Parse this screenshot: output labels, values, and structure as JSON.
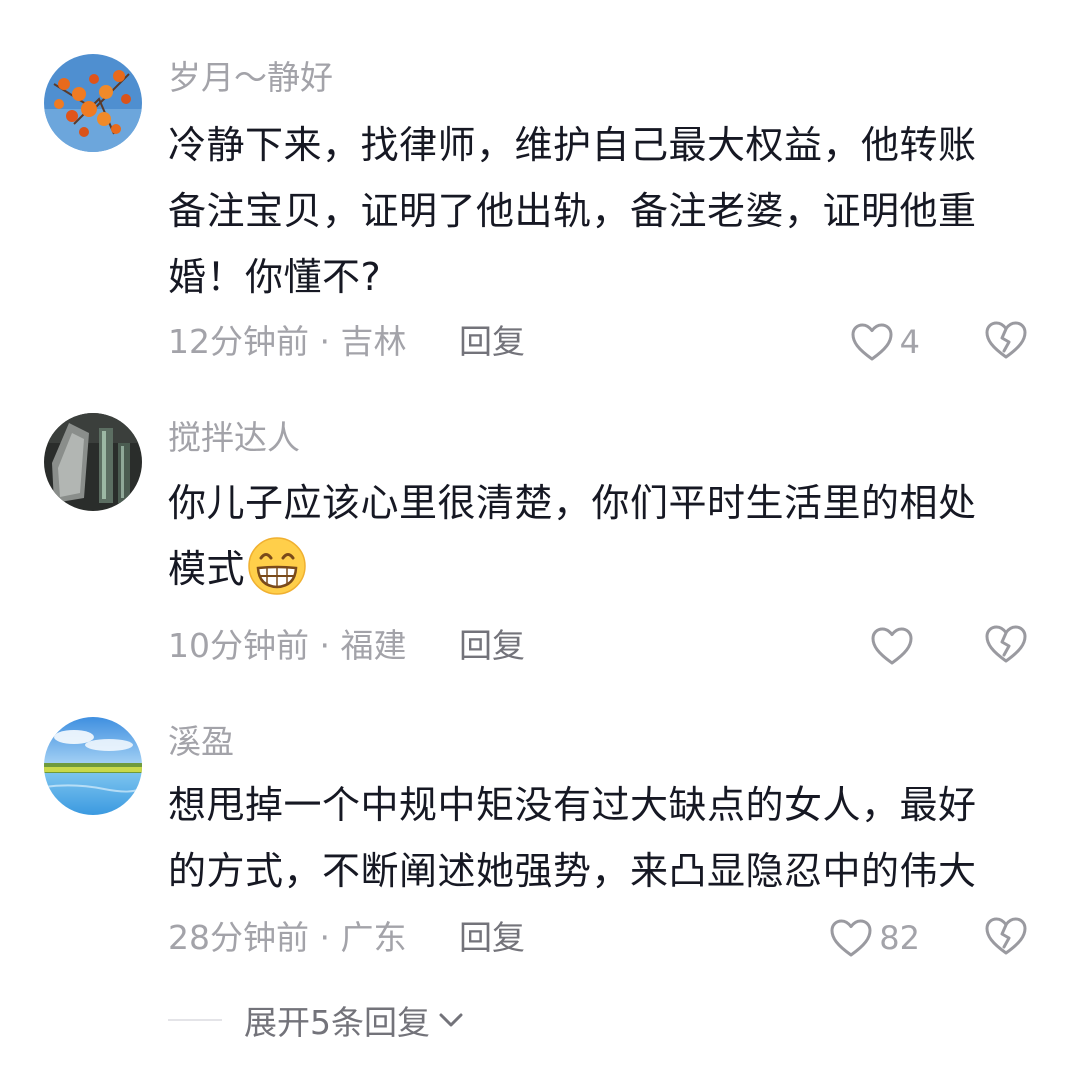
{
  "comments": [
    {
      "username": "岁月～静好",
      "lines": [
        "冷静下来，找律师，维护自己最大权益，他转账",
        "备注宝贝，证明了他出轨，备注老婆，证明他重",
        "婚！你懂不?"
      ],
      "time": "12分钟前",
      "location": "吉林",
      "likes": "4",
      "avatar_icon": "orange-persimmon-tree-avatar"
    },
    {
      "username": "搅拌达人",
      "lines": [
        "你儿子应该心里很清楚，你们平时生活里的相处",
        "模式"
      ],
      "emoji": "grinning-face-emoji",
      "time": "10分钟前",
      "location": "福建",
      "likes": "",
      "avatar_icon": "dark-glass-objects-avatar"
    },
    {
      "username": "溪盈",
      "lines": [
        "想甩掉一个中规中矩没有过大缺点的女人，最好",
        "的方式，不断阐述她强势，来凸显隐忍中的伟大"
      ],
      "time": "28分钟前",
      "location": "广东",
      "likes": "82",
      "avatar_icon": "blue-sky-lake-avatar"
    }
  ],
  "separator": "·",
  "reply_label": "回复",
  "expand_label": "展开5条回复",
  "colors": {
    "text_primary": "#161823",
    "text_secondary": "#a3a3a9",
    "text_action": "#73737a",
    "icon": "#9a9aa0"
  }
}
